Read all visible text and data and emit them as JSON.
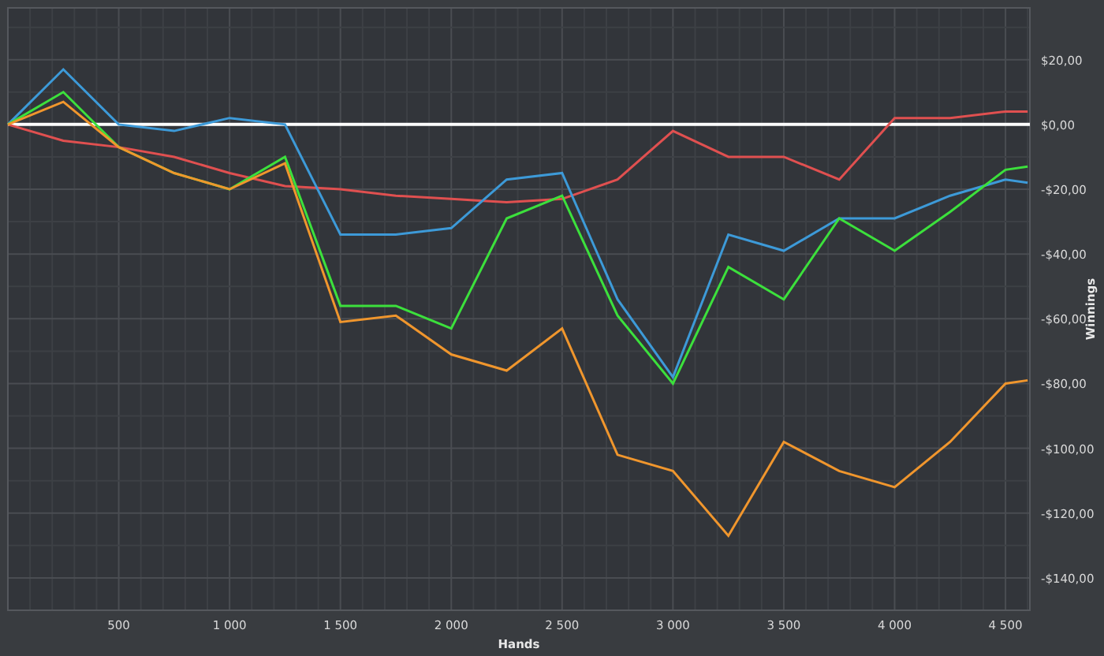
{
  "chart_data": {
    "type": "line",
    "xlabel": "Hands",
    "ylabel": "Winnings",
    "x": [
      0,
      250,
      500,
      750,
      1000,
      1250,
      1500,
      1750,
      2000,
      2250,
      2500,
      2750,
      3000,
      3250,
      3500,
      3750,
      4000,
      4250,
      4500,
      4600
    ],
    "series": [
      {
        "color": "#e05050",
        "values": [
          0,
          -5,
          -7,
          -10,
          -15,
          -19,
          -20,
          -22,
          -23,
          -24,
          -23,
          -17,
          -2,
          -10,
          -10,
          -17,
          2,
          2,
          4,
          4
        ]
      },
      {
        "color": "#3d9ad8",
        "values": [
          0,
          17,
          0,
          -2,
          2,
          0,
          -34,
          -34,
          -32,
          -17,
          -15,
          -54,
          -78,
          -34,
          -39,
          -29,
          -29,
          -22,
          -17,
          -18
        ]
      },
      {
        "color": "#3ce03c",
        "values": [
          0,
          10,
          -7,
          -15,
          -20,
          -10,
          -56,
          -56,
          -63,
          -29,
          -22,
          -59,
          -80,
          -44,
          -54,
          -29,
          -39,
          -27,
          -14,
          -13
        ]
      },
      {
        "color": "#f0962d",
        "values": [
          0,
          7,
          -7,
          -15,
          -20,
          -12,
          -61,
          -59,
          -71,
          -76,
          -63,
          -102,
          -107,
          -127,
          -98,
          -107,
          -112,
          -98,
          -80,
          -79
        ]
      }
    ],
    "grid": true,
    "xlim": [
      0,
      4610
    ],
    "ylim": [
      -150,
      36
    ],
    "xticks": [
      {
        "value": 500,
        "label": "500"
      },
      {
        "value": 1000,
        "label": "1 000"
      },
      {
        "value": 1500,
        "label": "1 500"
      },
      {
        "value": 2000,
        "label": "2 000"
      },
      {
        "value": 2500,
        "label": "2 500"
      },
      {
        "value": 3000,
        "label": "3 000"
      },
      {
        "value": 3500,
        "label": "3 500"
      },
      {
        "value": 4000,
        "label": "4 000"
      },
      {
        "value": 4500,
        "label": "4 500"
      }
    ],
    "yticks": [
      {
        "value": 20,
        "label": "$20,00"
      },
      {
        "value": 0,
        "label": "$0,00"
      },
      {
        "value": -20,
        "label": "-$20,00"
      },
      {
        "value": -40,
        "label": "-$40,00"
      },
      {
        "value": -60,
        "label": "-$60,00"
      },
      {
        "value": -80,
        "label": "-$80,00"
      },
      {
        "value": -100,
        "label": "-$100,00"
      },
      {
        "value": -120,
        "label": "-$120,00"
      },
      {
        "value": -140,
        "label": "-$140,00"
      }
    ]
  }
}
